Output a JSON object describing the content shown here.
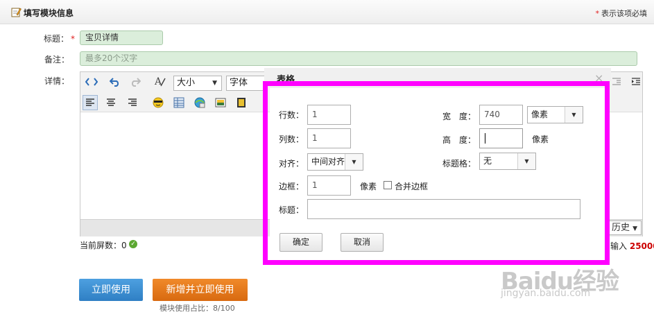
{
  "header": {
    "title": "填写模块信息",
    "required_star": "*",
    "required_note": "表示该项必填"
  },
  "form": {
    "title_label": "标题：",
    "title_star": "*",
    "title_value": "宝贝详情",
    "note_label": "备注：",
    "note_placeholder": "最多20个汉字",
    "detail_label": "详情："
  },
  "editor": {
    "size_select": "大小",
    "font_select": "字体",
    "history_select": "历史",
    "screen_count_label": "当前屏数：0",
    "input_count_label": "输入",
    "input_count_value": "25000"
  },
  "buttons": {
    "use_now": "立即使用",
    "add_and_use": "新增并立即使用"
  },
  "usage_text": "模块使用占比：8/100",
  "dialog": {
    "title": "表格",
    "close_glyph": "×",
    "rows_label": "行数：",
    "rows_value": "1",
    "cols_label": "列数：",
    "cols_value": "1",
    "align_label": "对齐：",
    "align_value": "中间对齐",
    "border_label": "边框：",
    "border_value": "1",
    "border_unit": "像素",
    "merge_border_label": "合并边框",
    "caption_label": "标题：",
    "caption_value": "",
    "width_label": "宽　度：",
    "width_value": "740",
    "width_unit": "像素",
    "height_label": "高　度：",
    "height_value": "",
    "height_unit": "像素",
    "header_cell_label": "标题格：",
    "header_cell_value": "无",
    "confirm": "确定",
    "cancel": "取消"
  },
  "watermark": {
    "brand": "Baidu经验",
    "url": "jingyan.baidu.com"
  },
  "colors": {
    "highlight": "#ff00ff",
    "primary_button": "#2f7fc4",
    "secondary_button": "#d86a10",
    "required": "#e02020"
  }
}
